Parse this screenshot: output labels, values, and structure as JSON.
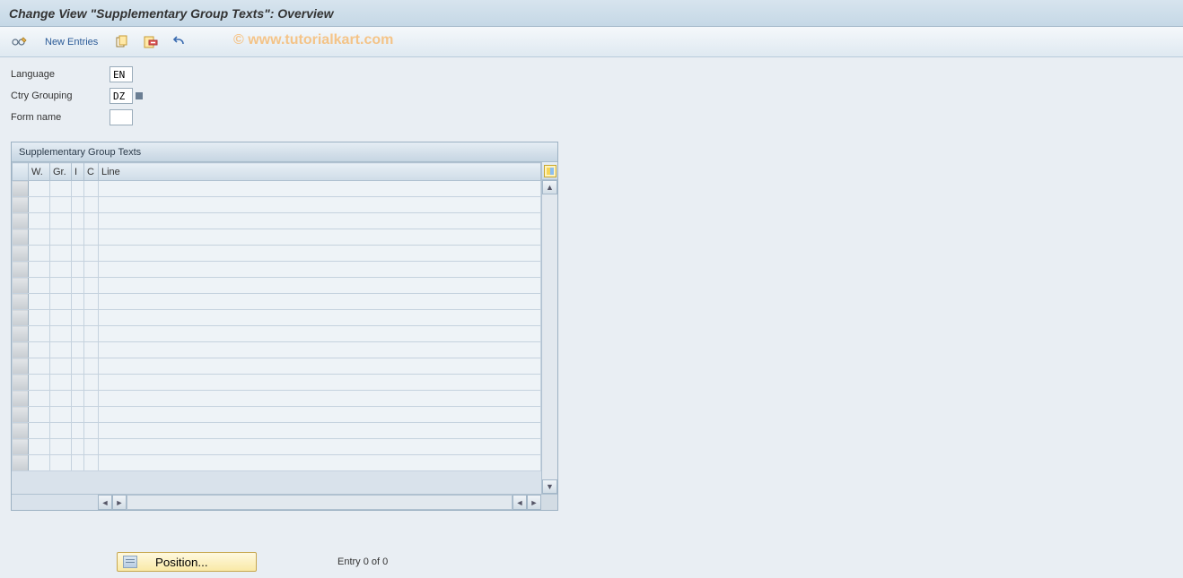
{
  "title": "Change View \"Supplementary Group Texts\": Overview",
  "watermark": "© www.tutorialkart.com",
  "toolbar": {
    "new_entries_label": "New Entries"
  },
  "form": {
    "language_label": "Language",
    "language_value": "EN",
    "ctry_grouping_label": "Ctry Grouping",
    "ctry_grouping_value": "DZ",
    "form_name_label": "Form name",
    "form_name_value": ""
  },
  "panel": {
    "title": "Supplementary Group Texts",
    "columns": {
      "w": "W.",
      "gr": "Gr.",
      "i": "I",
      "c": "C",
      "line": "Line"
    },
    "rows": [
      {
        "w": "",
        "gr": "",
        "i": "",
        "c": "",
        "line": ""
      },
      {
        "w": "",
        "gr": "",
        "i": "",
        "c": "",
        "line": ""
      },
      {
        "w": "",
        "gr": "",
        "i": "",
        "c": "",
        "line": ""
      },
      {
        "w": "",
        "gr": "",
        "i": "",
        "c": "",
        "line": ""
      },
      {
        "w": "",
        "gr": "",
        "i": "",
        "c": "",
        "line": ""
      },
      {
        "w": "",
        "gr": "",
        "i": "",
        "c": "",
        "line": ""
      },
      {
        "w": "",
        "gr": "",
        "i": "",
        "c": "",
        "line": ""
      },
      {
        "w": "",
        "gr": "",
        "i": "",
        "c": "",
        "line": ""
      },
      {
        "w": "",
        "gr": "",
        "i": "",
        "c": "",
        "line": ""
      },
      {
        "w": "",
        "gr": "",
        "i": "",
        "c": "",
        "line": ""
      },
      {
        "w": "",
        "gr": "",
        "i": "",
        "c": "",
        "line": ""
      },
      {
        "w": "",
        "gr": "",
        "i": "",
        "c": "",
        "line": ""
      },
      {
        "w": "",
        "gr": "",
        "i": "",
        "c": "",
        "line": ""
      },
      {
        "w": "",
        "gr": "",
        "i": "",
        "c": "",
        "line": ""
      },
      {
        "w": "",
        "gr": "",
        "i": "",
        "c": "",
        "line": ""
      },
      {
        "w": "",
        "gr": "",
        "i": "",
        "c": "",
        "line": ""
      },
      {
        "w": "",
        "gr": "",
        "i": "",
        "c": "",
        "line": ""
      },
      {
        "w": "",
        "gr": "",
        "i": "",
        "c": "",
        "line": ""
      }
    ]
  },
  "footer": {
    "position_label": "Position...",
    "entry_count": "Entry 0 of 0"
  },
  "colors": {
    "accent_blue_dark": "#2a5a97",
    "panel_border": "#9cb1c3",
    "grid_row": "#eef3f7"
  }
}
